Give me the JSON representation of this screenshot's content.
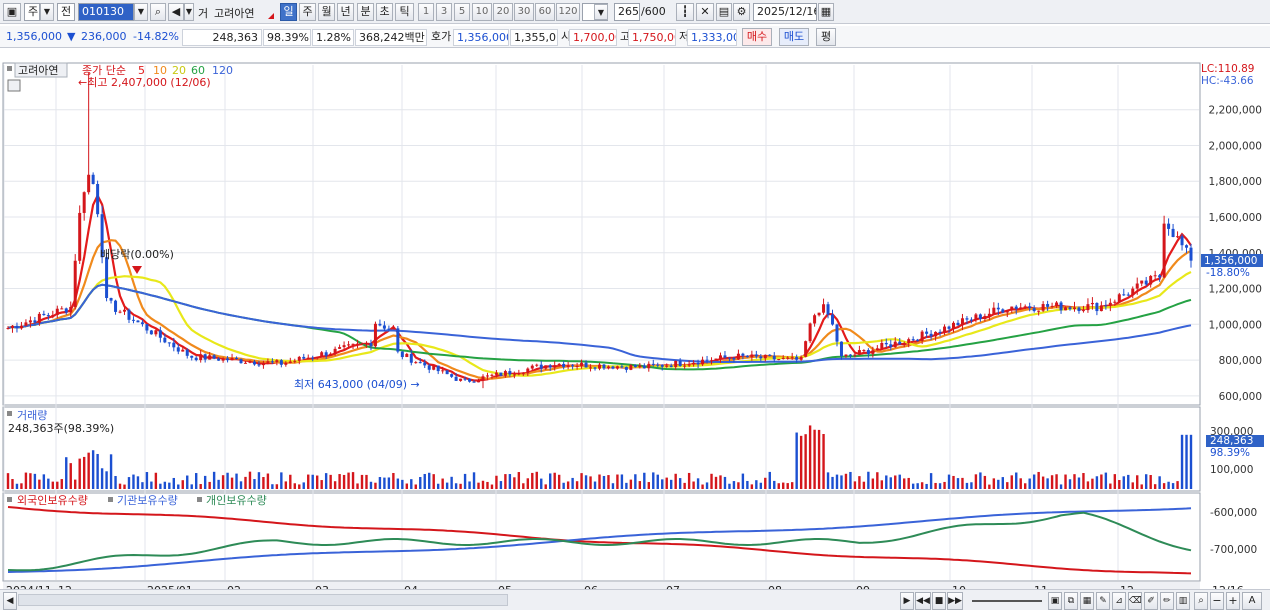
{
  "toolbar": {
    "market_label": "주",
    "type_label": "전",
    "code_value": "010130",
    "stock_kind": "거",
    "stock_name": "고려아연",
    "periods": [
      "일",
      "주",
      "월",
      "년",
      "분",
      "초",
      "틱"
    ],
    "active_period": "일",
    "intervals": [
      "1",
      "3",
      "5",
      "10",
      "20",
      "30",
      "60",
      "120"
    ],
    "bar_count": "265",
    "bar_total": "/600",
    "date_value": "2025/12/16"
  },
  "quote": {
    "price": "1,356,000",
    "change_arrow": "▼",
    "change": "236,000",
    "change_pct": "-14.82%",
    "volume": "248,363",
    "vol_ratio": "98.39%",
    "turnover": "1.28%",
    "amount": "368,242백만",
    "hoga_label": "호가",
    "ask": "1,356,000",
    "bid": "1,355,0",
    "open_label": "시",
    "open": "1,700,00",
    "high_label": "고",
    "high": "1,750,00",
    "low_label": "저",
    "low": "1,333,00",
    "buy_label": "매수",
    "sell_label": "매도",
    "avg_label": "평"
  },
  "price_panel": {
    "name_tag": "고려아연",
    "ma_label": "종가 단순",
    "ma_periods": [
      "5",
      "10",
      "20",
      "60",
      "120"
    ],
    "ma_colors": [
      "#e31b1b",
      "#f08a1c",
      "#e8e81a",
      "#25a244",
      "#3a63d8"
    ],
    "lc": "LC:110.89",
    "hc": "HC:-43.66",
    "y_ticks": [
      "2,200,000",
      "2,000,000",
      "1,800,000",
      "1,600,000",
      "1,400,000",
      "1,200,000",
      "1,000,000",
      "800,000",
      "600,000"
    ],
    "high_annot": "←최고 2,407,000 (12/06)",
    "low_annot": "최저 643,000 (04/09) →",
    "dividend_annot": "배당락(0.00%)",
    "last_price": "1,356,000",
    "last_change": "-18.80%"
  },
  "volume_panel": {
    "title": "거래량",
    "info": "248,363주(98.39%)",
    "y_ticks": [
      "300,000",
      "100,000"
    ],
    "last_volume": "248,363",
    "last_pct": "98.39%"
  },
  "holdings_panel": {
    "legends": [
      "외국인보유수량",
      "기관보유수량",
      "개인보유수량"
    ],
    "legend_colors": [
      "#d4161b",
      "#3a63d8",
      "#2e8b57"
    ],
    "y_ticks": [
      "-600,000",
      "-700,000"
    ]
  },
  "x_axis": {
    "labels": [
      "2024/11",
      "12",
      "2025/01",
      "02",
      "03",
      "04",
      "05",
      "06",
      "07",
      "08",
      "09",
      "10",
      "11",
      "12"
    ],
    "right_label": "12/16"
  },
  "chart_data": {
    "type": "candlestick",
    "period": "daily",
    "months": [
      "2024/11",
      "12",
      "2025/01",
      "02",
      "03",
      "04",
      "05",
      "06",
      "07",
      "08",
      "09",
      "10",
      "11",
      "12"
    ],
    "close_by_month_end": [
      980000,
      1150000,
      820000,
      780000,
      900000,
      680000,
      780000,
      760000,
      820000,
      790000,
      930000,
      1100000,
      1100000,
      1356000
    ],
    "period_high": {
      "value": 2407000,
      "date": "12/06"
    },
    "period_low": {
      "value": 643000,
      "date": "04/09"
    },
    "last_close": 1356000,
    "ylim": [
      560000,
      2450000
    ],
    "moving_averages": [
      "5",
      "10",
      "20",
      "60",
      "120"
    ]
  }
}
